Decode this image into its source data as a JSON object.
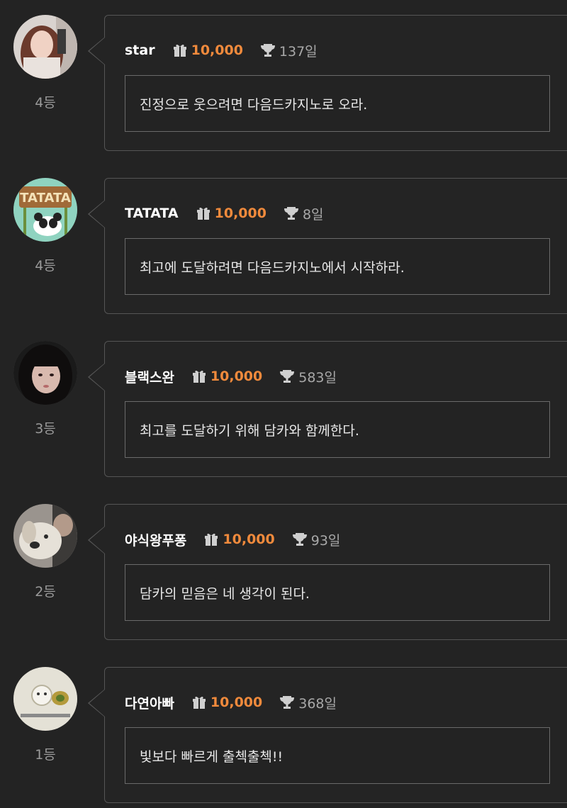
{
  "entries": [
    {
      "username": "star",
      "points": "10,000",
      "days": "137일",
      "rank": "4등",
      "message": "진정으로 웃으려면 다음드카지노로 오라."
    },
    {
      "username": "TATATA",
      "points": "10,000",
      "days": "8일",
      "rank": "4등",
      "message": "최고에 도달하려면 다음드카지노에서 시작하라.",
      "avatar_text": "TATATA"
    },
    {
      "username": "블랙스완",
      "points": "10,000",
      "days": "583일",
      "rank": "3등",
      "message": "최고를 도달하기 위해 담카와 함께한다."
    },
    {
      "username": "야식왕푸퐁",
      "points": "10,000",
      "days": "93일",
      "rank": "2등",
      "message": "담카의 믿음은 네 생각이 된다."
    },
    {
      "username": "다연아빠",
      "points": "10,000",
      "days": "368일",
      "rank": "1등",
      "message": "빛보다 빠르게 출첵출첵!!"
    }
  ],
  "icons": {
    "points": "gift-icon",
    "days": "trophy-icon"
  },
  "colors": {
    "background": "#232323",
    "points_accent": "#f08a3c",
    "border": "#555555",
    "text": "#e8e8e8"
  }
}
